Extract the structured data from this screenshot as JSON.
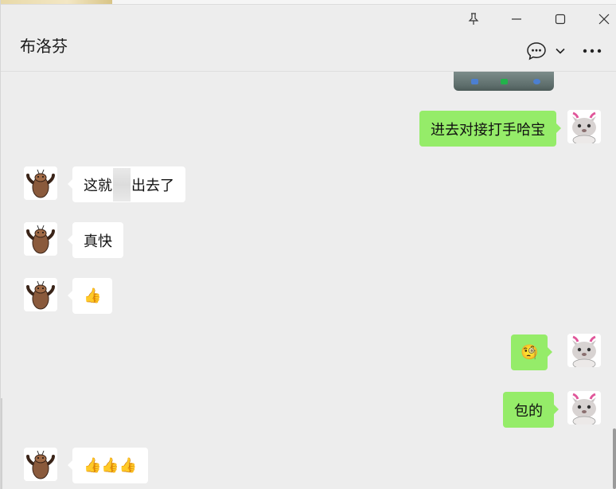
{
  "window": {
    "title": "布洛芬",
    "controls": [
      "pin-icon",
      "minimize-icon",
      "maximize-icon",
      "close-icon"
    ]
  },
  "header": {
    "chat_icon": "chat-bubble-icon",
    "dropdown_icon": "chevron-down-icon",
    "more_icon": "more-dots-icon"
  },
  "colors": {
    "background": "#ededed",
    "incoming_bubble": "#ffffff",
    "outgoing_bubble": "#95ec69",
    "text": "#111111"
  },
  "messages": [
    {
      "from": "me",
      "type": "image"
    },
    {
      "from": "me",
      "type": "text",
      "text": "进去对接打手哈宝"
    },
    {
      "from": "other",
      "type": "text",
      "text_before": "这就",
      "text_after": "出去了"
    },
    {
      "from": "other",
      "type": "text",
      "text": "真快"
    },
    {
      "from": "other",
      "type": "emoji",
      "text": "👍"
    },
    {
      "from": "me",
      "type": "emoji",
      "text": "🧐"
    },
    {
      "from": "me",
      "type": "text",
      "text": "包的"
    },
    {
      "from": "other",
      "type": "emoji",
      "text": "👍👍👍"
    }
  ]
}
